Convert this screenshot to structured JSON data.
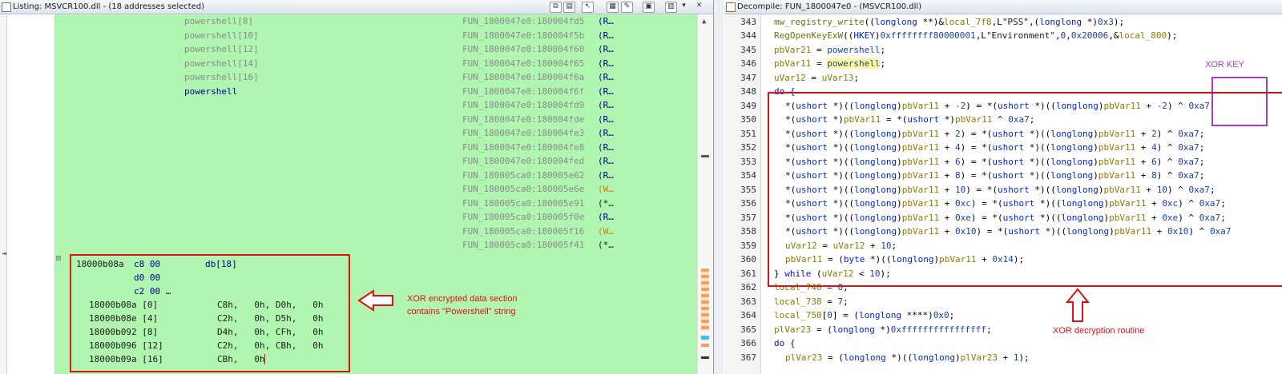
{
  "listing": {
    "title": "Listing:  MSVCR100.dll - (18 addresses selected)",
    "xrefs": [
      {
        "label": "powershell[8]",
        "ref": "FUN_1800047e0:180004fd5",
        "suffix": "(R…"
      },
      {
        "label": "powershell[10]",
        "ref": "FUN_1800047e0:180004f5b",
        "suffix": "(R…"
      },
      {
        "label": "powershell[12]",
        "ref": "FUN_1800047e0:180004f60",
        "suffix": "(R…"
      },
      {
        "label": "powershell[14]",
        "ref": "FUN_1800047e0:180004f65",
        "suffix": "(R…"
      },
      {
        "label": "powershell[16]",
        "ref": "FUN_1800047e0:180004f6a",
        "suffix": "(R…"
      },
      {
        "label": "powershell",
        "ref": "FUN_1800047e0:180004f6f",
        "suffix": "(R…"
      },
      {
        "label": "",
        "ref": "FUN_1800047e0:180004fd9",
        "suffix": "(R…"
      },
      {
        "label": "",
        "ref": "FUN_1800047e0:180004fde",
        "suffix": "(R…"
      },
      {
        "label": "",
        "ref": "FUN_1800047e0:180004fe3",
        "suffix": "(R…"
      },
      {
        "label": "",
        "ref": "FUN_1800047e0:180004fe8",
        "suffix": "(R…"
      },
      {
        "label": "",
        "ref": "FUN_1800047e0:180004fed",
        "suffix": "(R…"
      },
      {
        "label": "",
        "ref": "FUN_180005ca0:180005e62",
        "suffix": "(R…"
      },
      {
        "label": "",
        "ref": "FUN_180005ca0:180005e6e",
        "suffix": "(W…"
      },
      {
        "label": "",
        "ref": "FUN_180005ca0:180005e91",
        "suffix": "(*…"
      },
      {
        "label": "",
        "ref": "FUN_180005ca0:180005f0e",
        "suffix": "(R…"
      },
      {
        "label": "",
        "ref": "FUN_180005ca0:180005f16",
        "suffix": "(W…"
      },
      {
        "label": "",
        "ref": "FUN_180005ca0:180005f41",
        "suffix": "(*…"
      }
    ],
    "data_header": {
      "collapse": "⊟",
      "address": "18000b08a",
      "bytes": "c8 00",
      "type": "db[18]"
    },
    "data_cont": [
      "d0 00",
      "c2 00 …"
    ],
    "data_rows": [
      {
        "addr": "18000b08a [0]",
        "vals": "C8h,   0h, D0h,   0h"
      },
      {
        "addr": "18000b08e [4]",
        "vals": "C2h,   0h, D5h,   0h"
      },
      {
        "addr": "18000b092 [8]",
        "vals": "D4h,   0h, CFh,   0h"
      },
      {
        "addr": "18000b096 [12]",
        "vals": "C2h,   0h, CBh,   0h"
      },
      {
        "addr": "18000b09a [16]",
        "vals": "CBh,   0h"
      }
    ],
    "annotation_line1": "XOR encrypted data section",
    "annotation_line2": "contains \"Powershell\" string"
  },
  "decompile": {
    "title": "Decompile: FUN_1800047e0 - (MSVCR100.dll)",
    "line_numbers": [
      "343",
      "344",
      "345",
      "346",
      "347",
      "348",
      "349",
      "350",
      "351",
      "352",
      "353",
      "354",
      "355",
      "356",
      "357",
      "358",
      "359",
      "360",
      "361",
      "362",
      "363",
      "364",
      "365",
      "366",
      "367"
    ],
    "lines": [
      "mw_registry_write((longlong **)&local_7f8,L\"PSS\",(longlong *)0x3);",
      "RegOpenKeyExW((HKEY)0xffffffff80000001,L\"Environment\",0,0x20006,&local_800);",
      "pbVar21 = powershell;",
      "pbVar11 = powershell;",
      "uVar12 = uVar13;",
      "do {",
      "  *(ushort *)((longlong)pbVar11 + -2) = *(ushort *)((longlong)pbVar11 + -2) ^ 0xa7;",
      "  *(ushort *)pbVar11 = *(ushort *)pbVar11 ^ 0xa7;",
      "  *(ushort *)((longlong)pbVar11 + 2) = *(ushort *)((longlong)pbVar11 + 2) ^ 0xa7;",
      "  *(ushort *)((longlong)pbVar11 + 4) = *(ushort *)((longlong)pbVar11 + 4) ^ 0xa7;",
      "  *(ushort *)((longlong)pbVar11 + 6) = *(ushort *)((longlong)pbVar11 + 6) ^ 0xa7;",
      "  *(ushort *)((longlong)pbVar11 + 8) = *(ushort *)((longlong)pbVar11 + 8) ^ 0xa7;",
      "  *(ushort *)((longlong)pbVar11 + 10) = *(ushort *)((longlong)pbVar11 + 10) ^ 0xa7;",
      "  *(ushort *)((longlong)pbVar11 + 0xc) = *(ushort *)((longlong)pbVar11 + 0xc) ^ 0xa7;",
      "  *(ushort *)((longlong)pbVar11 + 0xe) = *(ushort *)((longlong)pbVar11 + 0xe) ^ 0xa7;",
      "  *(ushort *)((longlong)pbVar11 + 0x10) = *(ushort *)((longlong)pbVar11 + 0x10) ^ 0xa7",
      "  uVar12 = uVar12 + 10;",
      "  pbVar11 = (byte *)((longlong)pbVar11 + 0x14);",
      "} while (uVar12 < 10);",
      "local_740 = 0;",
      "local_738 = 7;",
      "local_750[0] = (longlong ****)0x0;",
      "plVar23 = (longlong *)0xffffffffffffffff;",
      "do {",
      "  plVar23 = (longlong *)((longlong)plVar23 + 1);"
    ],
    "xor_key_label": "XOR KEY",
    "routine_label": "XOR decryption routine"
  },
  "colors": {
    "listing_bg": "#b0f5b0",
    "annotation_red": "#e01010",
    "xor_key_purple": "#a040c0",
    "highlight_yellow": "#ffff9a"
  }
}
